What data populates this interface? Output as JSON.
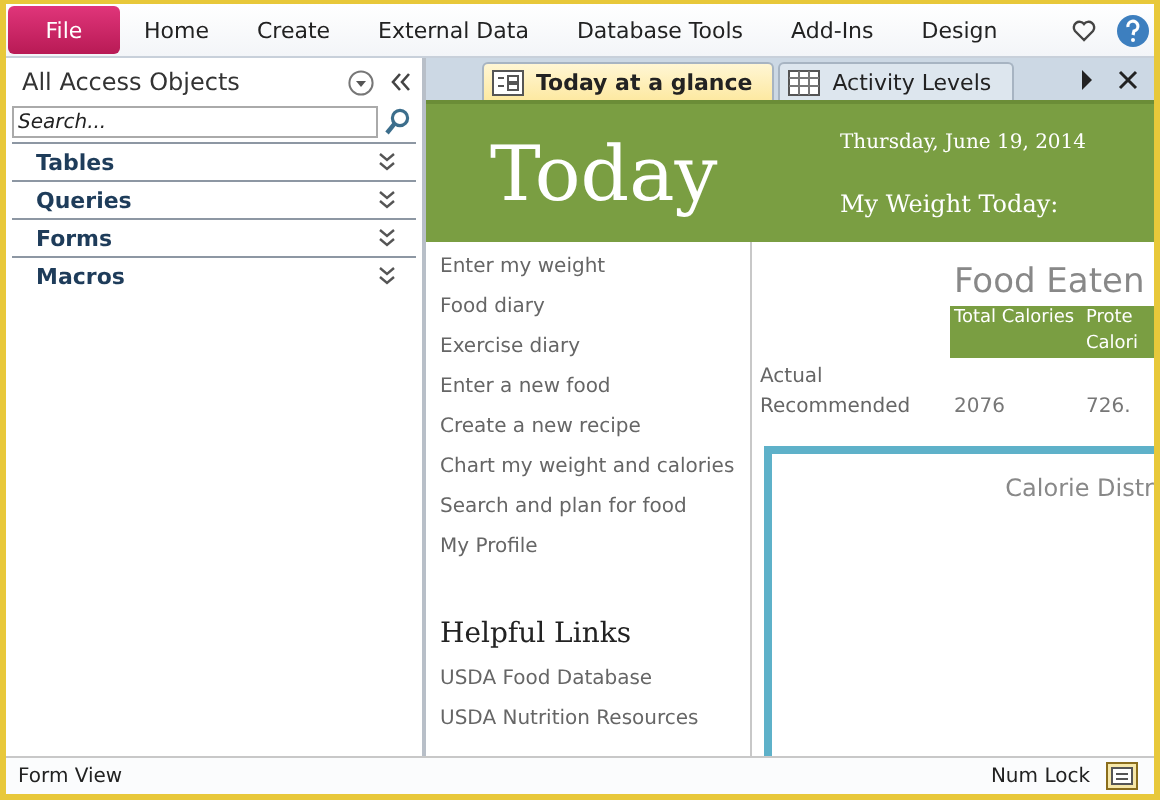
{
  "ribbon": {
    "file_label": "File",
    "tabs": [
      "Home",
      "Create",
      "External Data",
      "Database Tools",
      "Add-Ins",
      "Design"
    ]
  },
  "nav_pane": {
    "title": "All Access Objects",
    "search": {
      "placeholder": "Search..."
    },
    "groups": [
      "Tables",
      "Queries",
      "Forms",
      "Macros"
    ]
  },
  "doc_tabs": [
    {
      "label": "Today at a glance",
      "kind": "form",
      "selected": true
    },
    {
      "label": "Activity Levels",
      "kind": "table",
      "selected": false
    }
  ],
  "form": {
    "title": "Today",
    "date": "Thursday, June 19, 2014",
    "weight_label": "My Weight Today:",
    "links": [
      "Enter my weight",
      "Food diary",
      "Exercise diary",
      "Enter a new food",
      "Create a new recipe",
      "Chart my weight and calories",
      "Search and plan for food",
      "My Profile"
    ],
    "helpful_links_title": "Helpful Links",
    "helpful_links": [
      "USDA Food Database",
      "USDA Nutrition Resources"
    ],
    "food_eaten": {
      "title": "Food Eaten",
      "columns": [
        "Total Calories",
        "Prote Calori"
      ],
      "rows": [
        {
          "label": "Actual",
          "values": []
        },
        {
          "label": "Recommended",
          "values": [
            "2076",
            "726."
          ]
        }
      ]
    },
    "chart_title": "Calorie Distr"
  },
  "status_bar": {
    "view": "Form View",
    "num_lock": "Num Lock"
  }
}
